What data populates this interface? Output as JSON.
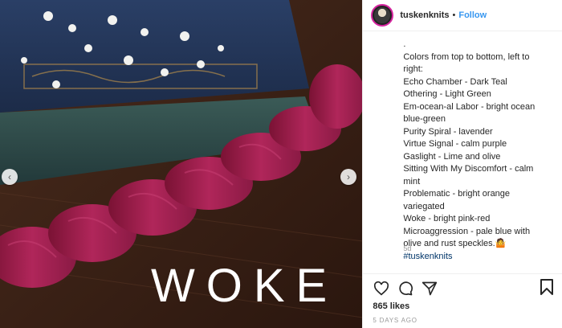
{
  "post": {
    "image_text": "WOKE",
    "prev_icon": "chevron-left-icon",
    "next_icon": "chevron-right-icon"
  },
  "header": {
    "username": "tuskenknits",
    "separator": "•",
    "follow_label": "Follow"
  },
  "caption": {
    "lines": [
      ".",
      "Colors from top to bottom, left to",
      "right:",
      "Echo Chamber - Dark Teal",
      "Othering - Light Green",
      "Em-ocean-al Labor - bright ocean",
      "blue-green",
      "Purity Spiral - lavender",
      "Virtue Signal - calm purple",
      "Gaslight - Lime and olive",
      "Sitting With My Discomfort - calm",
      "mint",
      "Problematic - bright orange",
      "variegated",
      "Woke - bright pink-red",
      "Microaggression - pale blue with",
      "olive and rust speckles.🤷"
    ],
    "hashtag": "#tuskenknits",
    "age": "5d"
  },
  "actions": {
    "like_icon": "heart-icon",
    "comment_icon": "comment-icon",
    "share_icon": "share-icon",
    "save_icon": "bookmark-icon"
  },
  "likes": "865 likes",
  "timestamp": "5 DAYS AGO"
}
